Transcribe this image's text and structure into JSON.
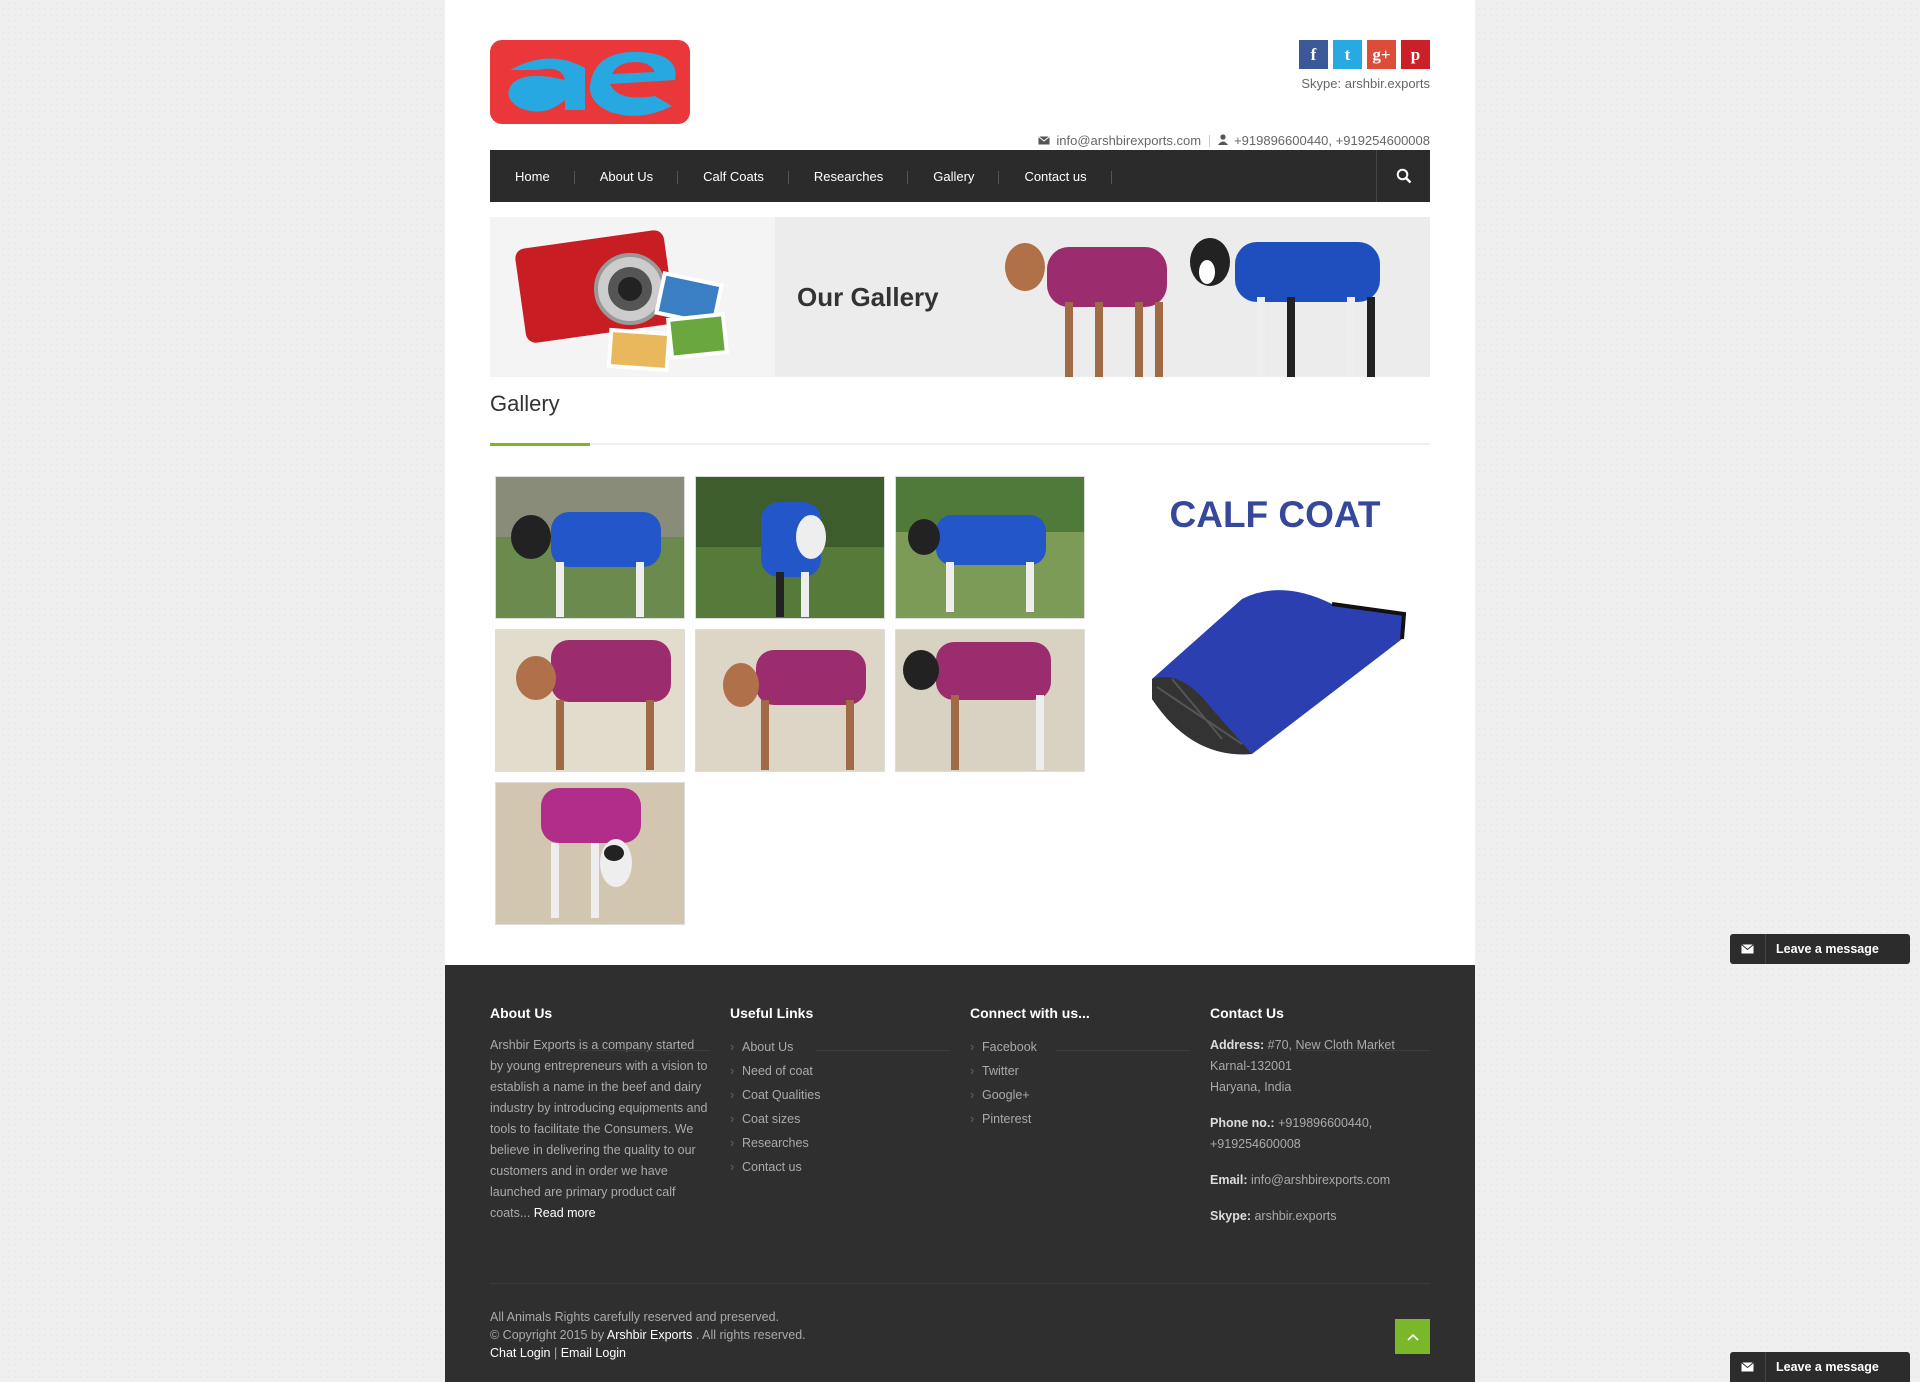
{
  "header": {
    "skype": "Skype: arshbir.exports",
    "email": "info@arshbirexports.com",
    "phone": "+919896600440, +919254600008",
    "social": [
      {
        "name": "facebook-icon",
        "glyph": "f",
        "color": "#3b5998"
      },
      {
        "name": "twitter-icon",
        "glyph": "t",
        "color": "#29a9e1"
      },
      {
        "name": "google-plus-icon",
        "glyph": "g+",
        "color": "#dd4b39"
      },
      {
        "name": "pinterest-icon",
        "glyph": "p",
        "color": "#cb2027"
      }
    ]
  },
  "nav": {
    "items": [
      "Home",
      "About Us",
      "Calf Coats",
      "Researches",
      "Gallery",
      "Contact us"
    ]
  },
  "banner": {
    "title": "Our Gallery"
  },
  "gallery": {
    "title": "Gallery",
    "promo_title": "CALF COAT"
  },
  "footer": {
    "about": {
      "title": "About Us",
      "text": "Arshbir Exports is a company started by young entrepreneurs with a vision to establish a name in the beef and dairy industry by introducing equipments and tools to facilitate the Consumers. We believe in delivering the quality to our customers and in order we have launched are primary product calf coats...",
      "read_more": "Read more"
    },
    "links": {
      "title": "Useful Links",
      "items": [
        "About Us",
        "Need of coat",
        "Coat Qualities",
        "Coat sizes",
        "Researches",
        "Contact us"
      ]
    },
    "connect": {
      "title": "Connect with us...",
      "items": [
        "Facebook",
        "Twitter",
        "Google+",
        "Pinterest"
      ]
    },
    "contact": {
      "title": "Contact Us",
      "address_label": "Address:",
      "address_line1": "#70, New Cloth Market",
      "address_line2": "Karnal-132001",
      "address_line3": "Haryana, India",
      "phone_label": "Phone no.:",
      "phone_line1": "+919896600440,",
      "phone_line2": "+919254600008",
      "email_label": "Email:",
      "email": "info@arshbirexports.com",
      "skype_label": "Skype:",
      "skype": "arshbir.exports"
    },
    "bottom": {
      "line1": "All Animals Rights carefully reserved and preserved.",
      "line2a": "© Copyright 2015 by ",
      "line2b": "Arshbir Exports",
      "line2c": " . All rights reserved.",
      "chat_login": "Chat Login",
      "separator": "|",
      "email_login": "Email Login"
    }
  },
  "chat_widget": {
    "label": "Leave a message"
  }
}
